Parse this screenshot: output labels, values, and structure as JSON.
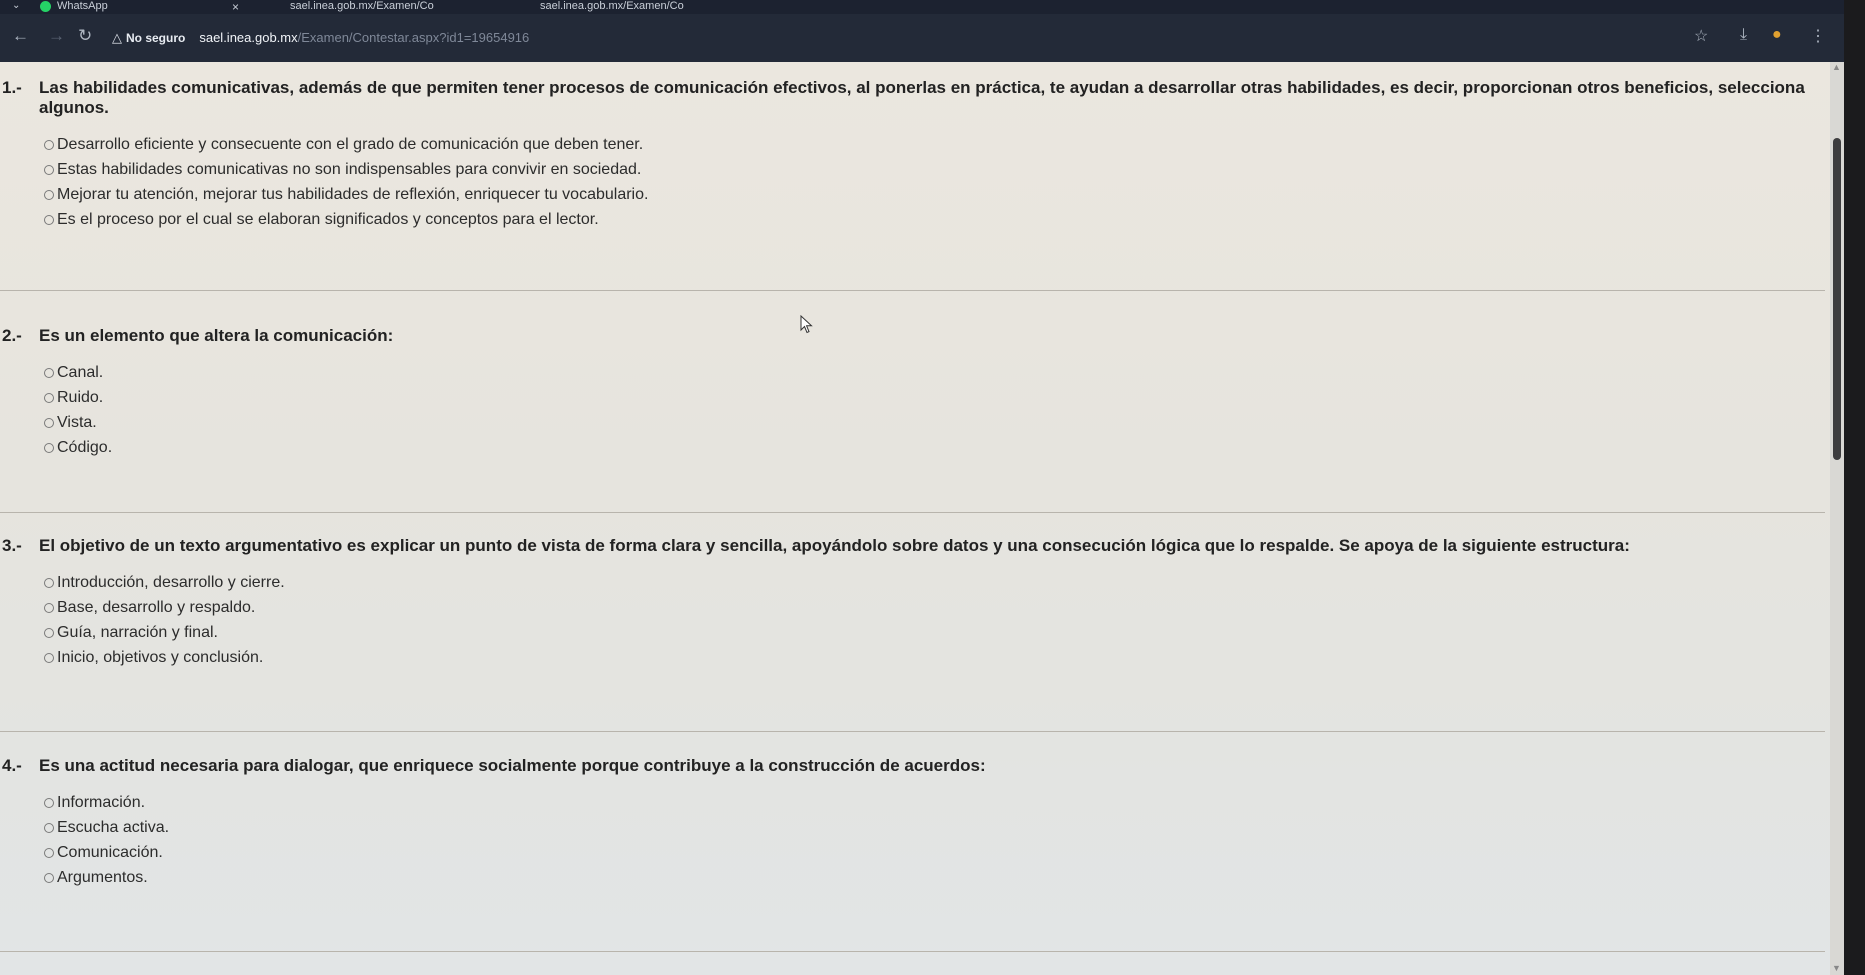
{
  "browser": {
    "tabs": [
      {
        "label": "WhatsApp"
      },
      {
        "label": "sael.inea.gob.mx/Examen/Co"
      },
      {
        "label": "sael.inea.gob.mx/Examen/Co"
      }
    ],
    "address": {
      "security_label": "No seguro",
      "host": "sael.inea.gob.mx",
      "path": "/Examen/Contestar.aspx?id1=19654916"
    }
  },
  "questions": [
    {
      "number": "1.-",
      "text": "Las habilidades comunicativas, además de que permiten tener procesos de comunicación efectivos, al ponerlas en práctica, te ayudan a desarrollar otras habilidades, es decir, proporcionan otros beneficios, selecciona algunos.",
      "options": [
        "Desarrollo eficiente y consecuente con el grado de comunicación que deben tener.",
        "Estas habilidades comunicativas no son indispensables para convivir en sociedad.",
        "Mejorar tu atención, mejorar tus habilidades de reflexión, enriquecer tu vocabulario.",
        "Es el proceso por el cual se elaboran significados y conceptos para el lector."
      ]
    },
    {
      "number": "2.-",
      "text": "Es un elemento que altera la comunicación:",
      "options": [
        "Canal.",
        "Ruido.",
        "Vista.",
        "Código."
      ]
    },
    {
      "number": "3.-",
      "text": "El objetivo de un texto argumentativo es explicar un punto de vista de forma clara y sencilla, apoyándolo sobre datos y una consecución lógica que lo respalde. Se apoya de la siguiente estructura:",
      "options": [
        "Introducción, desarrollo y cierre.",
        "Base, desarrollo y respaldo.",
        "Guía, narración y final.",
        "Inicio, objetivos y conclusión."
      ]
    },
    {
      "number": "4.-",
      "text": "Es una actitud necesaria para dialogar, que enriquece socialmente porque contribuye a la construcción de acuerdos:",
      "options": [
        "Información.",
        "Escucha activa.",
        "Comunicación.",
        "Argumentos."
      ]
    }
  ]
}
